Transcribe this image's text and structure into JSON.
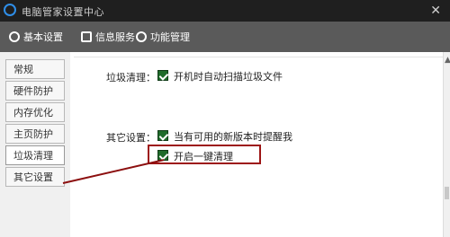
{
  "window": {
    "title": "电脑管家设置中心"
  },
  "tabs": [
    {
      "label": "基本设置"
    },
    {
      "label": "信息服务"
    },
    {
      "label": "功能管理"
    }
  ],
  "sidebar": {
    "items": [
      {
        "label": "常规"
      },
      {
        "label": "硬件防护"
      },
      {
        "label": "内存优化"
      },
      {
        "label": "主页防护"
      },
      {
        "label": "垃圾清理"
      },
      {
        "label": "其它设置"
      }
    ],
    "active_index": 4
  },
  "content": {
    "section1": {
      "label": "垃圾清理：",
      "option": "开机时自动扫描垃圾文件",
      "checked": true
    },
    "section2": {
      "label": "其它设置：",
      "options": [
        {
          "text": "当有可用的新版本时提醒我",
          "checked": true
        },
        {
          "text": "开启一键清理",
          "checked": true
        }
      ]
    }
  },
  "colors": {
    "title_bg": "#1f1f1f",
    "tabbar_bg": "#5a5a5a",
    "checkbox": "#1f6b2a",
    "highlight": "#9d1515"
  }
}
